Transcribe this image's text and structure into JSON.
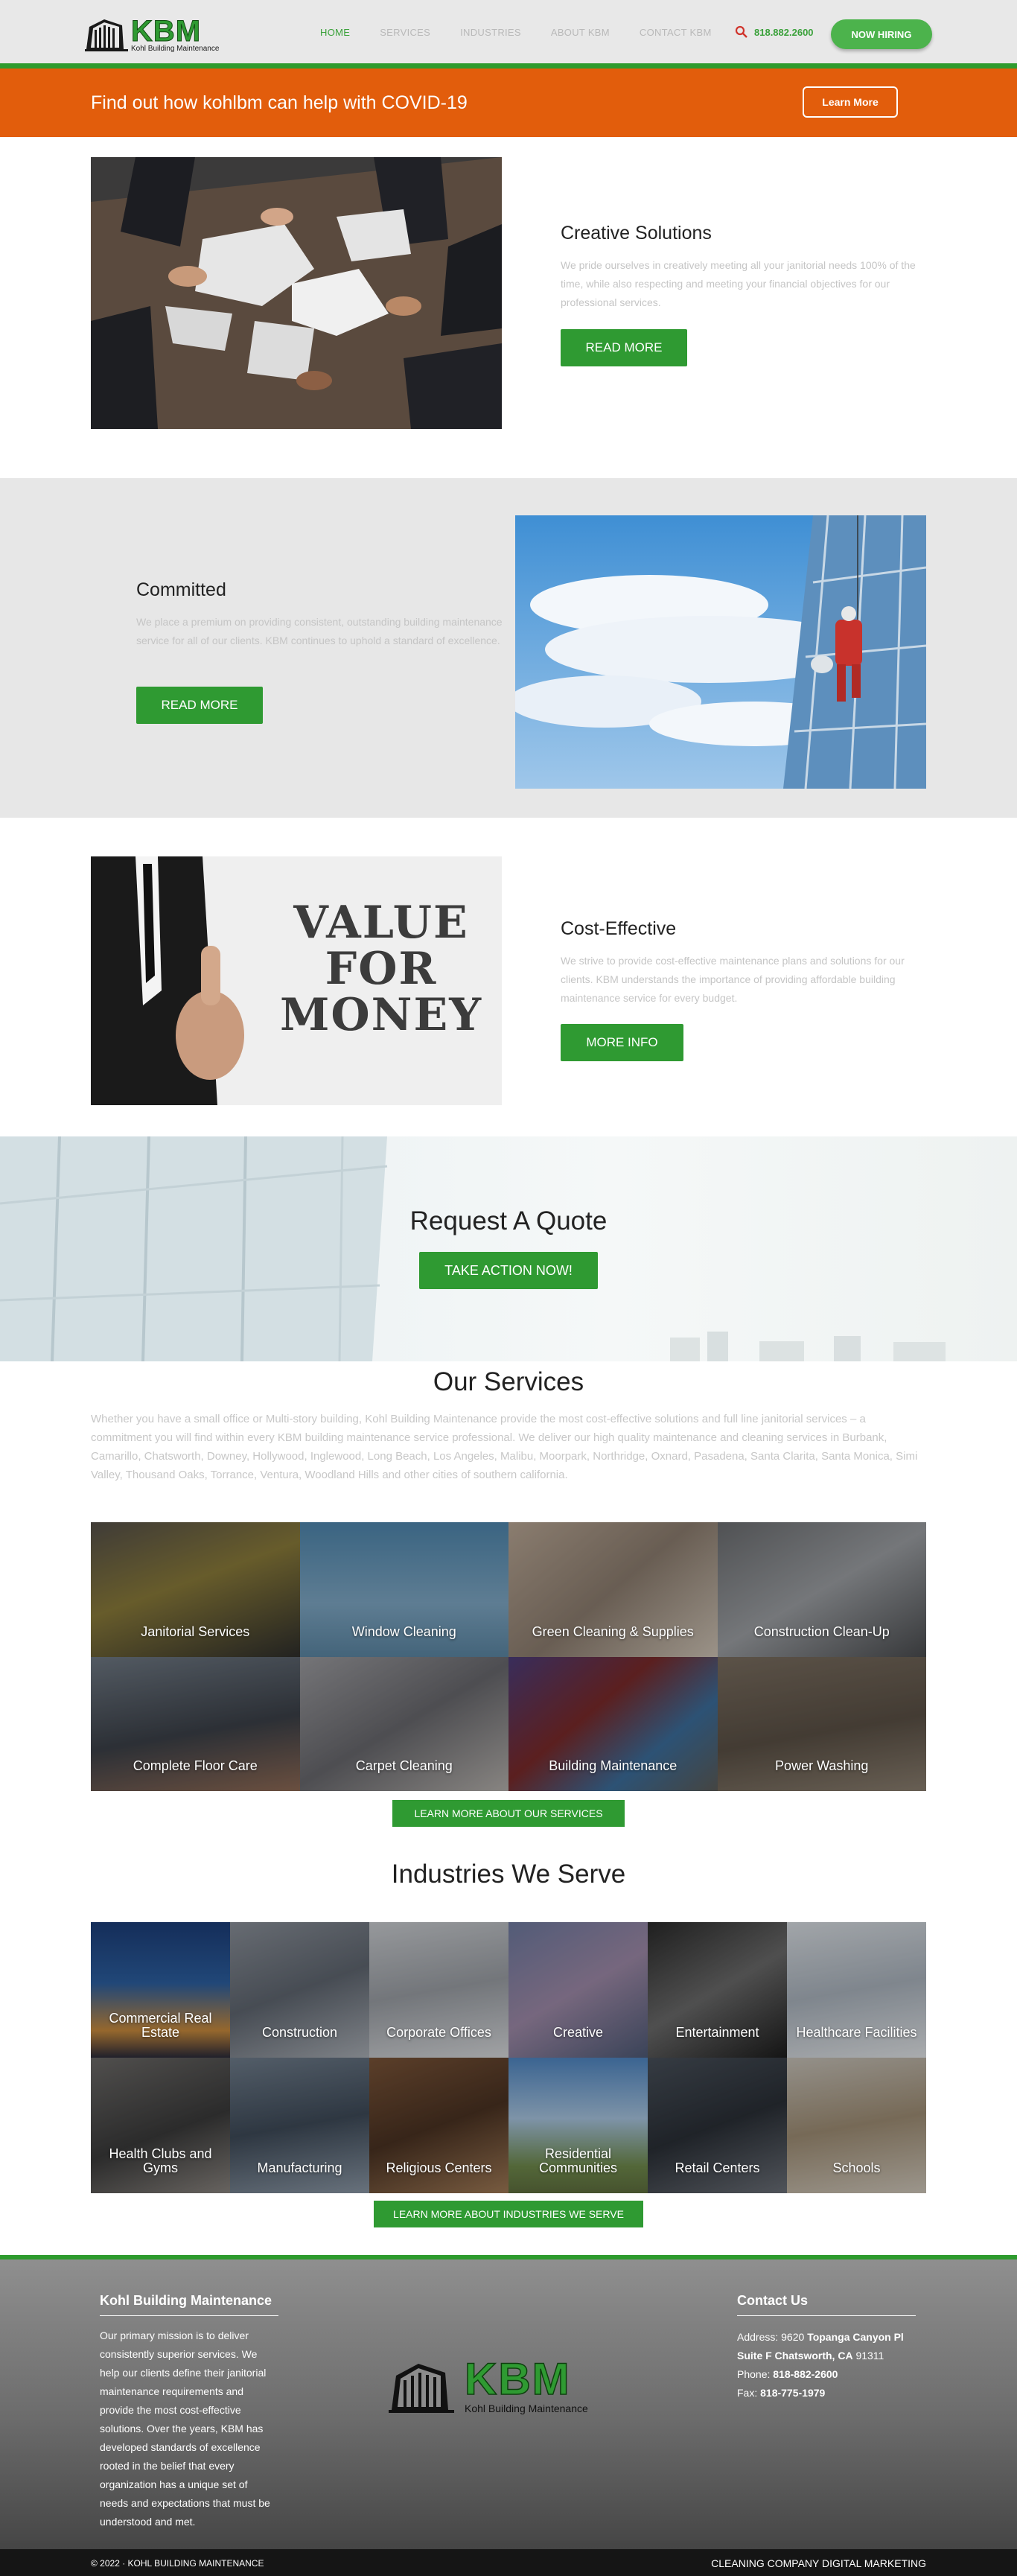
{
  "header": {
    "logo_text": "KBM",
    "logo_sub": "Kohl Building Maintenance",
    "nav": [
      {
        "label": "HOME",
        "active": true
      },
      {
        "label": "SERVICES",
        "active": false
      },
      {
        "label": "INDUSTRIES",
        "active": false
      },
      {
        "label": "ABOUT KBM",
        "active": false
      },
      {
        "label": "CONTACT KBM",
        "active": false
      }
    ],
    "phone": "818.882.2600",
    "hire_button": "NOW HIRING"
  },
  "covid": {
    "text": "Find out how kohlbm can help with COVID-19",
    "button": "Learn More"
  },
  "features": [
    {
      "title": "Creative Solutions",
      "text": "We pride ourselves in creatively meeting all your janitorial needs 100% of the time, while also respecting and meeting your financial objectives for our professional services.",
      "button": "READ MORE"
    },
    {
      "title": "Committed",
      "text": "We place a premium on providing consistent, outstanding building maintenance service for all of our clients. KBM continues to uphold a standard of excellence.",
      "button": "READ MORE"
    },
    {
      "title": "Cost-Effective",
      "text": "We strive to provide cost-effective maintenance plans and solutions for our clients. KBM understands the importance of providing affordable building maintenance service for every budget.",
      "button": "MORE INFO",
      "image_text": [
        "VALUE",
        "FOR",
        "MONEY"
      ]
    }
  ],
  "quote": {
    "title": "Request A Quote",
    "button": "TAKE ACTION NOW!"
  },
  "services": {
    "title": "Our Services",
    "text": "Whether you have a small office or Multi-story building, Kohl Building Maintenance provide the most cost-effective solutions and full line janitorial services – a commitment you will find within every KBM building maintenance service professional. We deliver our high quality maintenance and cleaning services in Burbank, Camarillo, Chatsworth, Downey, Hollywood, Inglewood, Long Beach, Los Angeles, Malibu, Moorpark, Northridge, Oxnard, Pasadena, Santa Clarita, Santa Monica, Simi Valley, Thousand Oaks, Torrance, Ventura, Woodland Hills and other cities of southern california.",
    "tiles": [
      "Janitorial Services",
      "Window Cleaning",
      "Green Cleaning & Supplies",
      "Construction Clean-Up",
      "Complete Floor Care",
      "Carpet Cleaning",
      "Building Maintenance",
      "Power Washing"
    ],
    "button": "LEARN MORE ABOUT OUR SERVICES"
  },
  "industries": {
    "title": "Industries We Serve",
    "tiles": [
      "Commercial Real Estate",
      "Construction",
      "Corporate Offices",
      "Creative",
      "Entertainment",
      "Healthcare Facilities",
      "Health Clubs and Gyms",
      "Manufacturing",
      "Religious Centers",
      "Residential Communities",
      "Retail Centers",
      "Schools"
    ],
    "button": "LEARN MORE ABOUT INDUSTRIES WE SERVE"
  },
  "footer": {
    "about_title": "Kohl Building Maintenance",
    "about_text": "Our primary mission is to deliver consistently superior services. We help our clients define their janitorial maintenance requirements and provide the most cost-effective solutions. Over the years, KBM has developed standards of excellence rooted in the belief that every organization has a unique set of needs and expectations that must be understood and met.",
    "contact_title": "Contact Us",
    "address_label": "Address:",
    "address_num": "9620",
    "address_street": "Topanga Canyon Pl",
    "address_suite": "Suite F Chatsworth, CA",
    "address_zip": "91311",
    "phone_label": "Phone:",
    "phone": "818-882-2600",
    "fax_label": "Fax:",
    "fax": "818-775-1979",
    "copyright": "© 2022 · KOHL BUILDING MAINTENANCE",
    "credit": "CLEANING COMPANY DIGITAL MARKETING"
  },
  "colors": {
    "brand_green": "#2f9a32",
    "covid_orange": "#e25d0c"
  }
}
